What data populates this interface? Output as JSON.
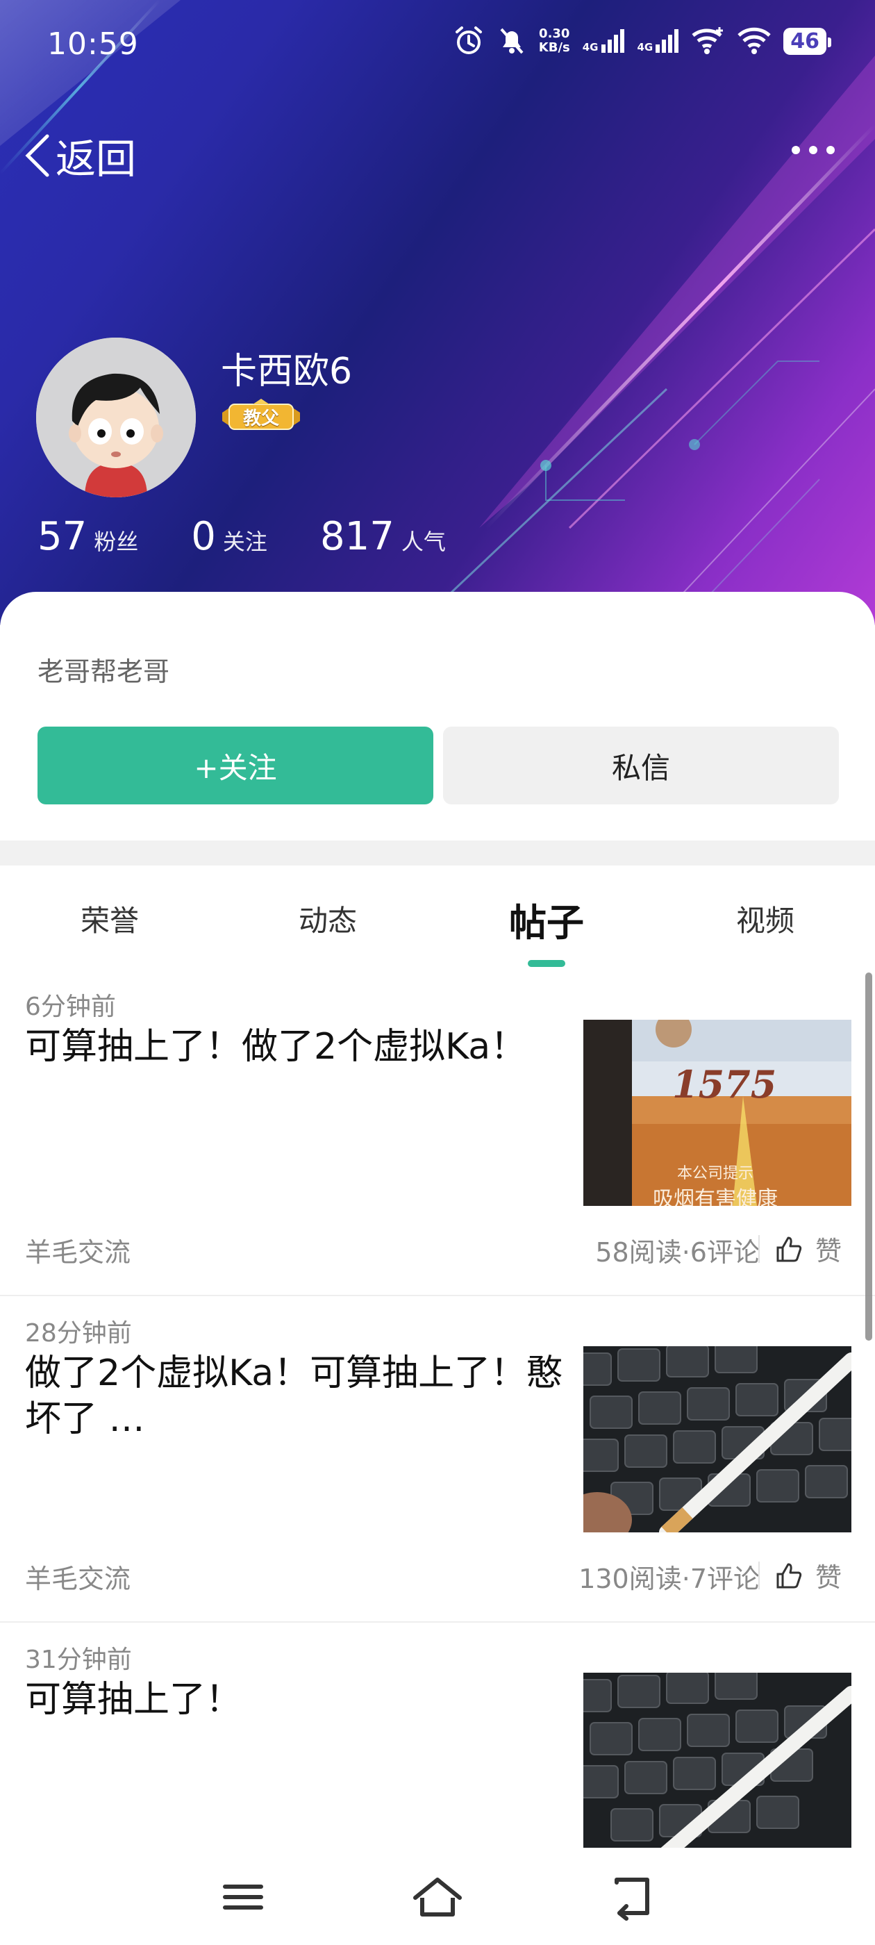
{
  "status_bar": {
    "time": "10:59",
    "net_speed_value": "0.30",
    "net_speed_unit": "KB/s",
    "signal1_gen": "4G",
    "signal2_gen": "4G",
    "battery": "46"
  },
  "header": {
    "back_label": "返回",
    "more_icon": "more-dots-icon"
  },
  "profile": {
    "username": "卡西欧6",
    "badge": "教父",
    "stats": [
      {
        "value": "57",
        "label": "粉丝"
      },
      {
        "value": "0",
        "label": "关注"
      },
      {
        "value": "817",
        "label": "人气"
      }
    ],
    "bio": "老哥帮老哥",
    "follow_button": "+关注",
    "message_button": "私信"
  },
  "tabs": [
    {
      "label": "荣誉",
      "active": false
    },
    {
      "label": "动态",
      "active": false
    },
    {
      "label": "帖子",
      "active": true
    },
    {
      "label": "视频",
      "active": false
    }
  ],
  "posts": [
    {
      "time": "6分钟前",
      "title": "可算抽上了！做了2个虚拟Ka！",
      "category": "羊毛交流",
      "stats": "58阅读·6评论",
      "like_label": "赞",
      "thumb_text": "1575",
      "thumb_notice": "本公司提示",
      "thumb_warning": "吸烟有害健康"
    },
    {
      "time": "28分钟前",
      "title": "做了2个虚拟Ka！可算抽上了！憨坏了 …",
      "category": "羊毛交流",
      "stats": "130阅读·7评论",
      "like_label": "赞"
    },
    {
      "time": "31分钟前",
      "title": "可算抽上了！"
    }
  ],
  "colors": {
    "accent": "#33bb97",
    "header_gradient_start": "#2b2fb6",
    "header_gradient_end": "#b23bd6"
  }
}
